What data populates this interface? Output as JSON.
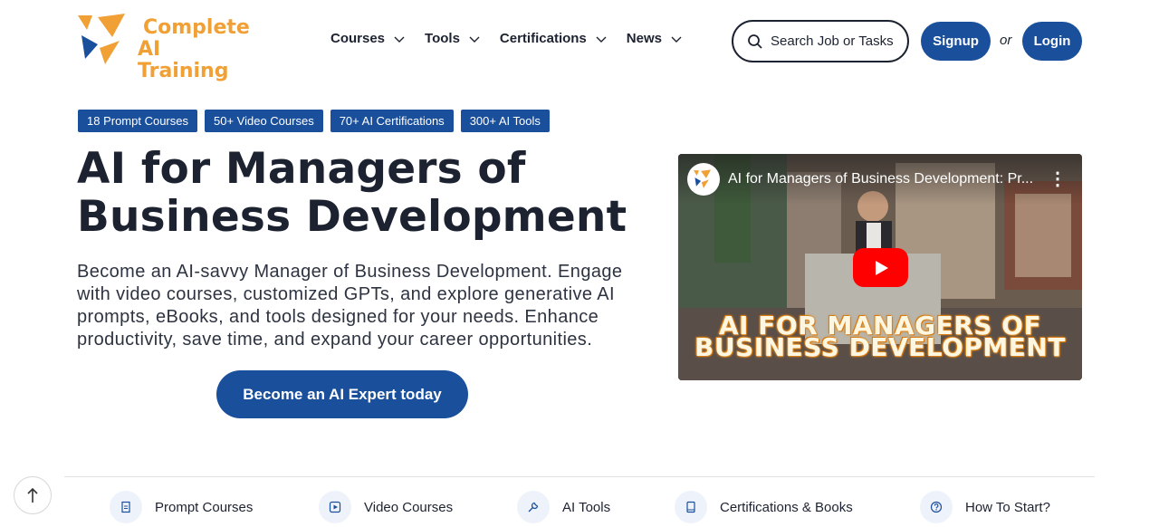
{
  "brand": {
    "line1": "Complete",
    "line2": "AI Training",
    "color": "#f0a035"
  },
  "nav": [
    {
      "label": "Courses"
    },
    {
      "label": "Tools"
    },
    {
      "label": "Certifications"
    },
    {
      "label": "News"
    }
  ],
  "search": {
    "placeholder": "Search Job or Tasks"
  },
  "auth": {
    "signup": "Signup",
    "or": "or",
    "login": "Login"
  },
  "badges": [
    "18 Prompt Courses",
    "50+ Video Courses",
    "70+ AI Certifications",
    "300+ AI Tools"
  ],
  "hero": {
    "title": "AI for Managers of Business Development",
    "description": "Become an AI-savvy Manager of Business Development. Engage with video courses, customized GPTs, and explore generative AI prompts, eBooks, and tools designed for your needs. Enhance productivity, save time, and expand your career opportunities.",
    "cta": "Become an AI Expert today"
  },
  "video": {
    "title": "AI for Managers of Business Development: Pr...",
    "channel": "Complete AI Training",
    "overlay_line1": "AI FOR MANAGERS OF",
    "overlay_line2": "BUSINESS DEVELOPMENT"
  },
  "bottom_tabs": [
    {
      "label": "Prompt Courses",
      "icon": "document-icon"
    },
    {
      "label": "Video Courses",
      "icon": "play-square-icon"
    },
    {
      "label": "AI Tools",
      "icon": "wrench-icon"
    },
    {
      "label": "Certifications & Books",
      "icon": "book-icon"
    },
    {
      "label": "How To Start?",
      "icon": "help-circle-icon"
    }
  ],
  "colors": {
    "primary": "#1a4f9c",
    "accent": "#f0a035",
    "youtube_red": "#ff0000"
  }
}
